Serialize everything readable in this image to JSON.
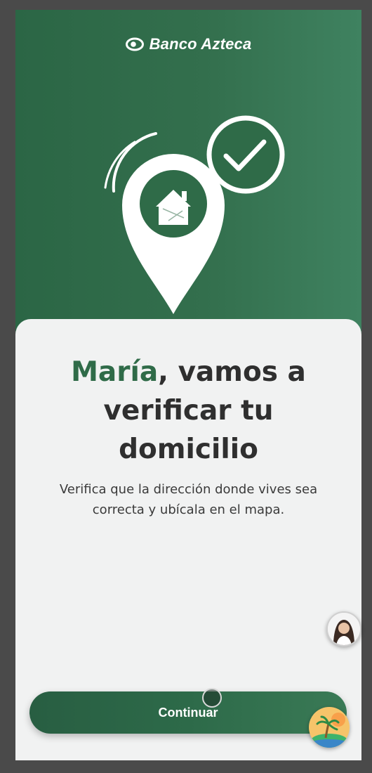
{
  "header": {
    "brand_name": "Banco Azteca",
    "logo_icon": "banco-azteca-eye-logo"
  },
  "illustration": {
    "icon": "location-pin-house-checkmark-icon"
  },
  "card": {
    "title_name": "María",
    "title_rest": ", vamos a verificar tu domicilio",
    "subtitle": "Verifica que la dirección donde vives sea correcta y ubícala en el mapa."
  },
  "actions": {
    "continue_label": "Continuar"
  },
  "floating": {
    "assistant_icon": "assistant-avatar-icon",
    "game_icon": "palm-island-icon"
  },
  "colors": {
    "brand_green": "#2f6b48",
    "background_green": "#336f4d",
    "card_bg": "#f1f2f2",
    "text_dark": "#2f2f2f"
  }
}
